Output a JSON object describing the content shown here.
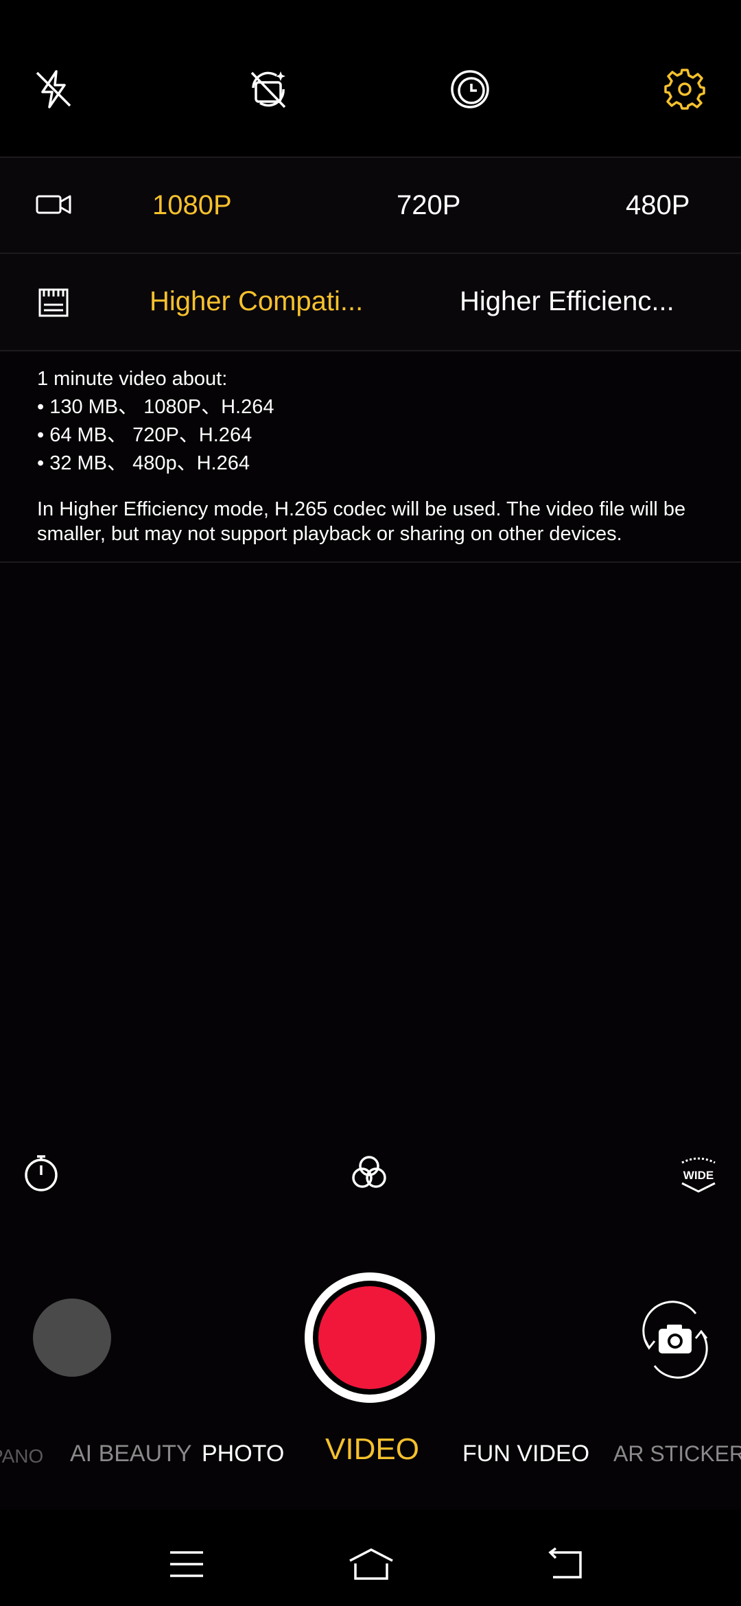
{
  "resolution": {
    "options": [
      "1080P",
      "720P",
      "480P"
    ],
    "selected": "1080P"
  },
  "codec": {
    "options": [
      "Higher Compati...",
      "Higher Efficienc..."
    ],
    "selected": "Higher Compati..."
  },
  "info": {
    "heading": "1 minute video about:",
    "items": [
      "• 130 MB、 1080P、H.264",
      "• 64 MB、 720P、H.264",
      "• 32 MB、 480p、H.264"
    ],
    "note": "In Higher Efficiency mode, H.265 codec will be used. The video file will be smaller, but may not support playback or sharing on other devices."
  },
  "modes": [
    "PANO",
    "AI BEAUTY",
    "PHOTO",
    "VIDEO",
    "FUN VIDEO",
    "AR STICKERS"
  ],
  "active_mode": "VIDEO",
  "tools": {
    "wide_label": "WIDE"
  },
  "colors": {
    "accent": "#f6c12d",
    "record": "#f0173b",
    "background": "#050305"
  },
  "icons": [
    "flash-off-icon",
    "ai-scene-off-icon",
    "timer-clock-icon",
    "settings-gear-icon",
    "video-camera-icon",
    "sd-card-icon",
    "stopwatch-icon",
    "filters-icon",
    "wide-angle-icon",
    "switch-camera-icon",
    "menu-icon",
    "home-icon",
    "back-icon"
  ]
}
